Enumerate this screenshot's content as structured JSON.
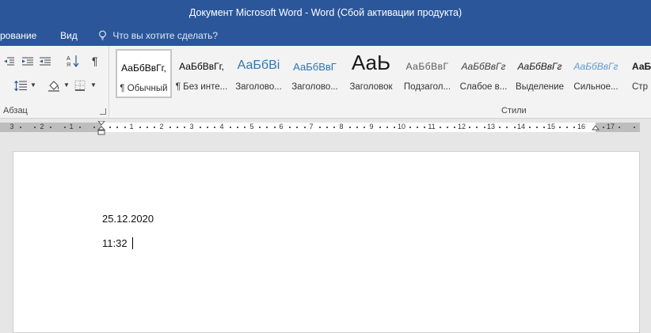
{
  "window": {
    "title": "Документ Microsoft Word - Word (Сбой активации продукта)"
  },
  "tabs": [
    {
      "label": "рование"
    },
    {
      "label": "Вид"
    }
  ],
  "tell_me": {
    "placeholder": "Что вы хотите сделать?"
  },
  "ribbon": {
    "paragraph_group_label": "Абзац",
    "styles_group_label": "Стили",
    "styles": [
      {
        "preview": "АаБбВвГг,",
        "name": "¶ Обычный",
        "color": "#000000"
      },
      {
        "preview": "АаБбВвГг,",
        "name": "¶ Без инте...",
        "color": "#000000"
      },
      {
        "preview": "АаБбВі",
        "name": "Заголово...",
        "color": "#2e74b5"
      },
      {
        "preview": "АаБбВвГ",
        "name": "Заголово...",
        "color": "#2e74b5"
      },
      {
        "preview": "АаЬ",
        "name": "Заголовок",
        "color": "#1a1a1a"
      },
      {
        "preview": "АаБбВвГ",
        "name": "Подзагол...",
        "color": "#595959"
      },
      {
        "preview": "АаБбВвГг",
        "name": "Слабое в...",
        "color": "#404040"
      },
      {
        "preview": "АаБбВвГг",
        "name": "Выделение",
        "color": "#1a1a1a"
      },
      {
        "preview": "АаБбВвГг",
        "name": "Сильное...",
        "color": "#5b9bd5"
      },
      {
        "preview": "АаБ",
        "name": "Стр",
        "color": "#1a1a1a"
      }
    ]
  },
  "ruler": {
    "numbers": [
      "3",
      "2",
      "1",
      "1",
      "2",
      "3",
      "4",
      "5",
      "6",
      "7",
      "8",
      "9",
      "10",
      "11",
      "12",
      "13",
      "14",
      "15",
      "16",
      "17"
    ]
  },
  "document": {
    "lines": [
      "25.12.2020",
      "11:32"
    ]
  },
  "colors": {
    "accent": "#2b579a",
    "ribbon_bg": "#f3f3f3",
    "workspace_bg": "#e6e6e6"
  }
}
